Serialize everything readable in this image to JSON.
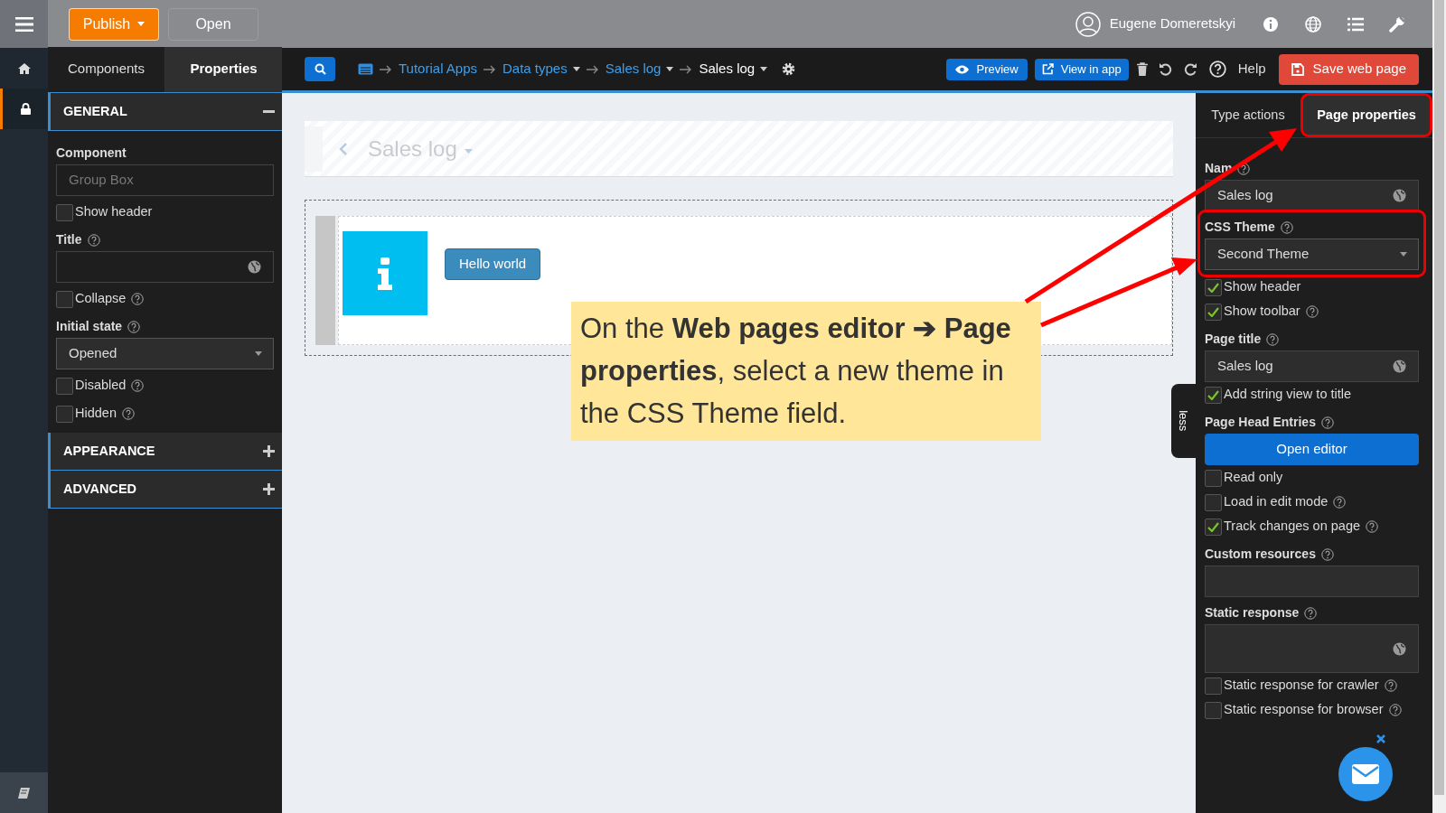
{
  "top_bar": {
    "publish_button": "Publish",
    "open_button": "Open",
    "user_name": "Eugene Domeretskyi"
  },
  "rail": [
    {
      "selected": false
    },
    {
      "selected": true
    }
  ],
  "panel_tabs": [
    {
      "label": "Components",
      "selected": false
    },
    {
      "label": "Properties",
      "selected": true
    }
  ],
  "breadcrumb": [
    {
      "label": "Tutorial Apps",
      "link": true,
      "dropdown": false
    },
    {
      "label": "Data types",
      "link": true,
      "dropdown": true
    },
    {
      "label": "Sales log",
      "link": true,
      "dropdown": true
    },
    {
      "label": "Sales log",
      "link": false,
      "dropdown": true
    }
  ],
  "toolbar": {
    "preview": "Preview",
    "view_in_app": "View in app",
    "help": "Help",
    "save": "Save web page"
  },
  "left_sections": [
    {
      "title": "GENERAL",
      "expanded": true,
      "fields": [
        {
          "kind": "input",
          "label": "Component",
          "help": false,
          "placeholder": "Group Box",
          "globe": false
        },
        {
          "kind": "checkbox",
          "label": "Show header",
          "checked": false,
          "help": false
        },
        {
          "kind": "input",
          "label": "Title",
          "help": true,
          "globe": true
        },
        {
          "kind": "checkbox",
          "label": "Collapse",
          "checked": false,
          "help": true
        },
        {
          "kind": "select",
          "label": "Initial state",
          "help": true,
          "value": "Opened"
        },
        {
          "kind": "checkbox",
          "label": "Disabled",
          "checked": false,
          "help": true
        },
        {
          "kind": "checkbox",
          "label": "Hidden",
          "checked": false,
          "help": true
        }
      ]
    },
    {
      "title": "APPEARANCE",
      "expanded": false
    },
    {
      "title": "ADVANCED",
      "expanded": false
    }
  ],
  "canvas": {
    "page_title": "Sales log",
    "button": "Hello world"
  },
  "right_tabs": [
    {
      "label": "Type actions",
      "selected": false,
      "highlighted": false
    },
    {
      "label": "Page properties",
      "selected": true,
      "highlighted": true
    }
  ],
  "right_fields": [
    {
      "kind": "input",
      "label": "Nam",
      "help": true,
      "value": "Sales log",
      "globe": true,
      "highlighted": false
    },
    {
      "kind": "select",
      "label": "CSS Theme",
      "help": true,
      "value": "Second Theme",
      "highlighted": true
    },
    {
      "kind": "checkbox",
      "label": "Show header",
      "checked": true,
      "help": false
    },
    {
      "kind": "checkbox",
      "label": "Show toolbar",
      "checked": true,
      "help": true
    },
    {
      "kind": "input",
      "label": "Page title",
      "help": true,
      "value": "Sales log",
      "globe": true,
      "highlighted": false
    },
    {
      "kind": "checkbox",
      "label": "Add string view to title",
      "checked": true,
      "help": false
    },
    {
      "kind": "button",
      "label": "Page Head Entries",
      "help": true,
      "button": "Open editor"
    },
    {
      "kind": "checkbox",
      "label": "Read only",
      "checked": false,
      "help": false
    },
    {
      "kind": "checkbox",
      "label": "Load in edit mode",
      "checked": false,
      "help": true
    },
    {
      "kind": "checkbox",
      "label": "Track changes on page",
      "checked": true,
      "help": true
    },
    {
      "kind": "input",
      "label": "Custom resources",
      "help": true,
      "globe": false,
      "highlighted": false
    },
    {
      "kind": "textarea",
      "label": "Static response",
      "help": true,
      "globe": true
    },
    {
      "kind": "checkbox",
      "label": "Static response for crawler",
      "checked": false,
      "help": true
    },
    {
      "kind": "checkbox",
      "label": "Static response for browser",
      "checked": false,
      "help": true
    }
  ],
  "side_tab": "less",
  "annotation": {
    "text": "On the **Web pages editor ➔ Page properties**, select a new theme in the CSS Theme field."
  }
}
